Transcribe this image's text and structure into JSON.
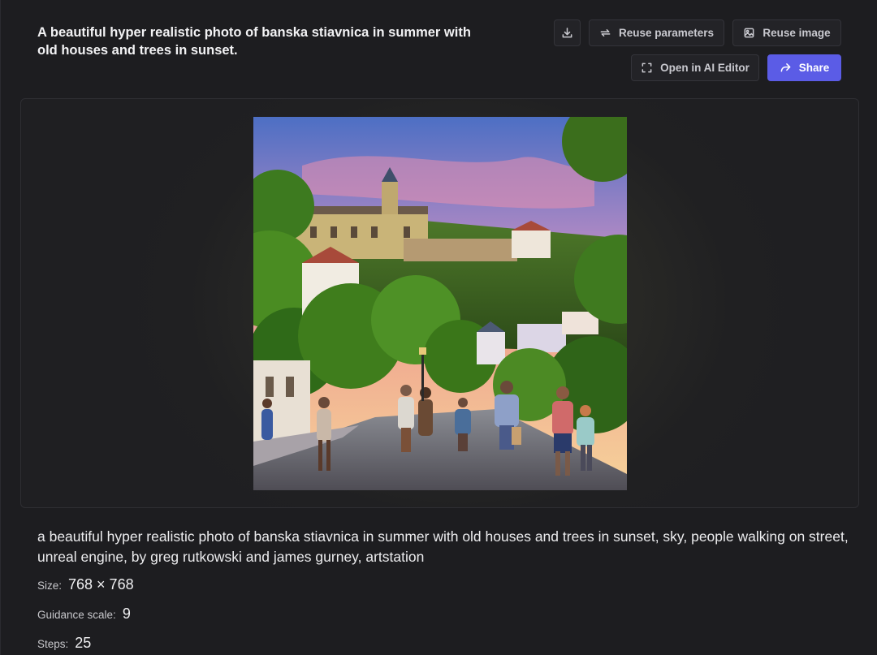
{
  "header": {
    "title": "A beautiful hyper realistic photo of banska stiavnica in summer with old houses and trees in sunset."
  },
  "toolbar": {
    "download_icon": "download-icon",
    "reuse_parameters_label": "Reuse parameters",
    "reuse_image_label": "Reuse image",
    "open_editor_label": "Open in AI Editor",
    "share_label": "Share",
    "accent_color": "#5b5ce6"
  },
  "image": {
    "description_icon": "generated-image"
  },
  "details": {
    "prompt": "a beautiful hyper realistic photo of banska stiavnica in summer with old houses and trees in sunset, sky, people walking on street, unreal engine, by greg rutkowski and james gurney, artstation",
    "size_label": "Size:",
    "size_value": "768 × 768",
    "guidance_label": "Guidance scale:",
    "guidance_value": "9",
    "steps_label": "Steps:",
    "steps_value": "25"
  }
}
